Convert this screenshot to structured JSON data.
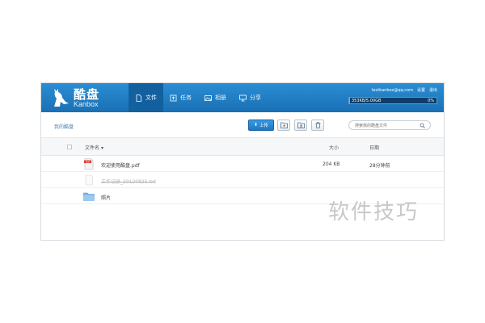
{
  "header": {
    "logo_cn": "酷盘",
    "logo_en": "Kanbox",
    "nav": [
      {
        "label": "文件",
        "icon": "file-icon",
        "active": true
      },
      {
        "label": "任务",
        "icon": "task-icon",
        "active": false
      },
      {
        "label": "相册",
        "icon": "photo-icon",
        "active": false
      },
      {
        "label": "分享",
        "icon": "share-icon",
        "active": false
      }
    ],
    "account": {
      "email": "testkanbox@qq.com",
      "settings": "设置",
      "logout": "退出",
      "quota_text": "353KB/5.00GB",
      "quota_percent": "0%",
      "quota_fraction": 0.0
    }
  },
  "toolbar": {
    "breadcrumb": "我的酷盘",
    "upload_label": "上传",
    "search_placeholder": "搜索我的酷盘文件"
  },
  "table": {
    "columns": {
      "name": "文件名",
      "size": "大小",
      "date": "日期"
    },
    "rows": [
      {
        "type": "pdf",
        "name": "欢迎使用酷盘.pdf",
        "size": "204 KB",
        "date": "28分钟前"
      },
      {
        "type": "txt",
        "name": "工作记录_20120825.txt",
        "size": "",
        "date": ""
      },
      {
        "type": "folder",
        "name": "照片",
        "size": "",
        "date": ""
      }
    ]
  },
  "watermark": "软件技巧",
  "colors": {
    "header_blue": "#1f7cc4",
    "nav_active": "#13609f",
    "link_blue": "#4a7fb0"
  }
}
